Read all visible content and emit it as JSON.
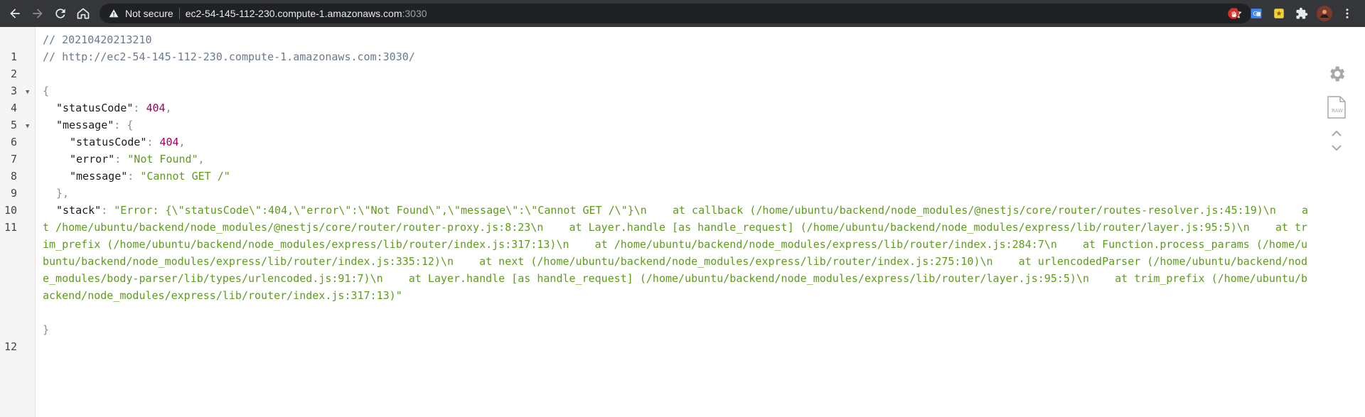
{
  "browser": {
    "security_label": "Not secure",
    "host": "ec2-54-145-112-230.compute-1.amazonaws.com",
    "port": ":3030",
    "colors": {
      "toolbar": "#35363a",
      "omnibox": "#202124"
    }
  },
  "viewer": {
    "line_numbers": [
      "1",
      "2",
      "3",
      "4",
      "5",
      "6",
      "7",
      "8",
      "9",
      "10",
      "11",
      "12"
    ],
    "comment_timestamp": "// 20210420213210",
    "comment_url": "// http://ec2-54-145-112-230.compute-1.amazonaws.com:3030/",
    "open_brace": "{",
    "close_brace": "}",
    "nested_close": "},",
    "key_statusCode": "\"statusCode\"",
    "val_statusCode": "404",
    "key_message": "\"message\"",
    "key_error": "\"error\"",
    "val_error": "\"Not Found\"",
    "val_message": "\"Cannot GET /\"",
    "key_stack": "\"stack\"",
    "val_stack": "\"Error: {\\\"statusCode\\\":404,\\\"error\\\":\\\"Not Found\\\",\\\"message\\\":\\\"Cannot GET /\\\"}\\n    at callback (/home/ubuntu/backend/node_modules/@nestjs/core/router/routes-resolver.js:45:19)\\n    at /home/ubuntu/backend/node_modules/@nestjs/core/router/router-proxy.js:8:23\\n    at Layer.handle [as handle_request] (/home/ubuntu/backend/node_modules/express/lib/router/layer.js:95:5)\\n    at trim_prefix (/home/ubuntu/backend/node_modules/express/lib/router/index.js:317:13)\\n    at /home/ubuntu/backend/node_modules/express/lib/router/index.js:284:7\\n    at Function.process_params (/home/ubuntu/backend/node_modules/express/lib/router/index.js:335:12)\\n    at next (/home/ubuntu/backend/node_modules/express/lib/router/index.js:275:10)\\n    at urlencodedParser (/home/ubuntu/backend/node_modules/body-parser/lib/types/urlencoded.js:91:7)\\n    at Layer.handle [as handle_request] (/home/ubuntu/backend/node_modules/express/lib/router/layer.js:95:5)\\n    at trim_prefix (/home/ubuntu/backend/node_modules/express/lib/router/index.js:317:13)\"",
    "colors": {
      "key": "#1b1b1b",
      "number": "#a1005e",
      "string": "#5e9c1c",
      "comment": "#6a7a8c"
    }
  },
  "side_tools": {
    "settings_icon": "gear-icon",
    "raw_icon": "raw-file-icon",
    "raw_label": "RAW",
    "collapse_icon": "chevron-up-down-icon"
  }
}
